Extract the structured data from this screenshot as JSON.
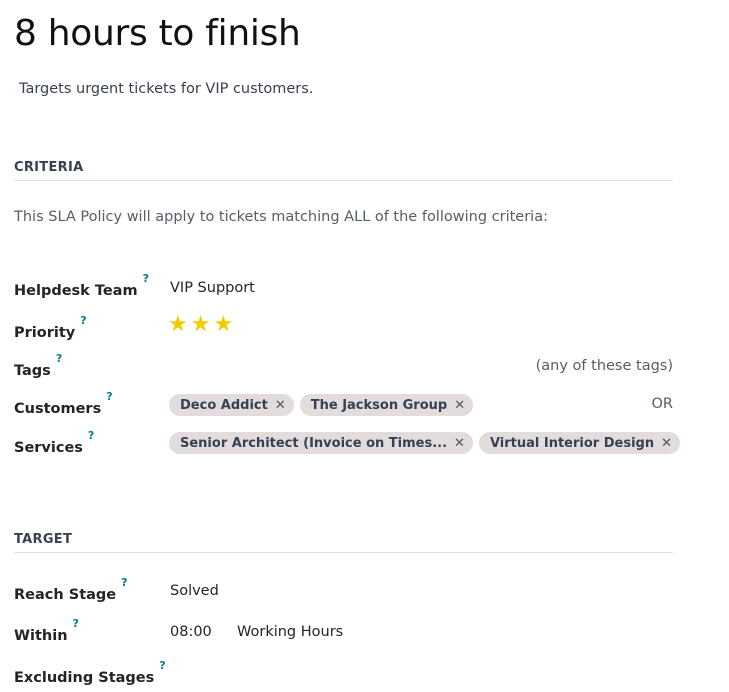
{
  "header": {
    "title": "8 hours to finish",
    "description": "Targets urgent tickets for VIP customers."
  },
  "criteria": {
    "section_title": "CRITERIA",
    "intro": "This SLA Policy will apply to tickets matching ALL of the following criteria:",
    "helpdesk_team": {
      "label": "Helpdesk Team",
      "help": "?",
      "value": "VIP Support"
    },
    "priority": {
      "label": "Priority",
      "help": "?",
      "stars_filled": 3,
      "stars_total": 3
    },
    "tags": {
      "label": "Tags",
      "help": "?",
      "hint": "(any of these tags)"
    },
    "customers": {
      "label": "Customers",
      "help": "?",
      "hint": "OR",
      "items": [
        "Deco Addict",
        "The Jackson Group"
      ]
    },
    "services": {
      "label": "Services",
      "help": "?",
      "items": [
        "Senior Architect (Invoice on Times...",
        "Virtual Interior Design"
      ]
    }
  },
  "target": {
    "section_title": "TARGET",
    "reach_stage": {
      "label": "Reach Stage",
      "help": "?",
      "value": "Solved"
    },
    "within": {
      "label": "Within",
      "help": "?",
      "time": "08:00",
      "unit": "Working Hours"
    },
    "excluding_stages": {
      "label": "Excluding Stages",
      "help": "?"
    }
  },
  "icons": {
    "star": "star-icon",
    "remove": "close-icon"
  },
  "colors": {
    "star": "#f3cc00",
    "tag_bg": "#e3dcdc",
    "help": "#017e84"
  }
}
